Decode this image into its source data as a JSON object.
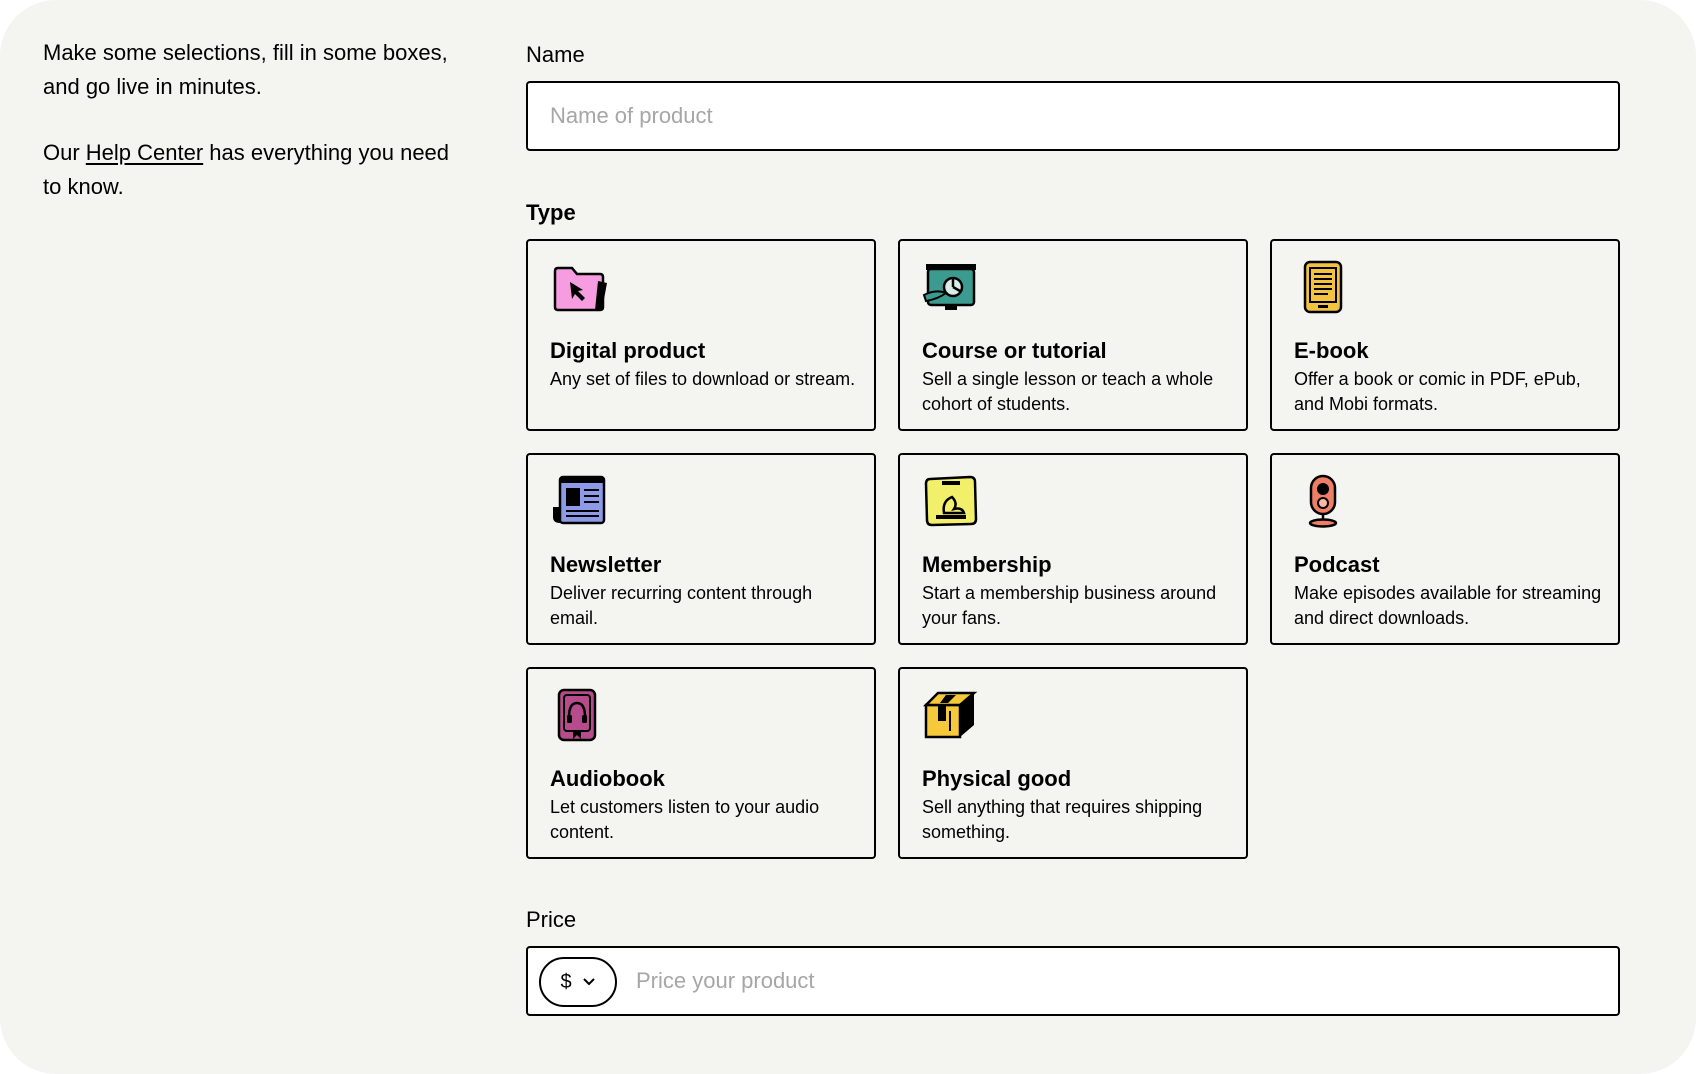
{
  "intro": {
    "line1": "Make some selections, fill in some boxes, and go live in minutes.",
    "prefix": "Our ",
    "help_link": "Help Center",
    "suffix": " has everything you need to know."
  },
  "name_field": {
    "label": "Name",
    "placeholder": "Name of product",
    "value": ""
  },
  "type_section": {
    "label": "Type",
    "cards": [
      {
        "title": "Digital product",
        "description": "Any set of files to download or stream.",
        "icon": "folder-cursor-icon",
        "color": "#f59de0"
      },
      {
        "title": "Course or tutorial",
        "description": "Sell a single lesson or teach a whole cohort of students.",
        "icon": "presentation-board-icon",
        "color": "#3c9b8f"
      },
      {
        "title": "E-book",
        "description": "Offer a book or comic in PDF, ePub, and Mobi formats.",
        "icon": "ebook-reader-icon",
        "color": "#f1c33e"
      },
      {
        "title": "Newsletter",
        "description": "Deliver recurring content through email.",
        "icon": "newspaper-icon",
        "color": "#8d9ae8"
      },
      {
        "title": "Membership",
        "description": "Start a membership business around your fans.",
        "icon": "membership-card-icon",
        "color": "#f2ef6a"
      },
      {
        "title": "Podcast",
        "description": "Make episodes available for streaming and direct downloads.",
        "icon": "microphone-icon",
        "color": "#ee7f64"
      },
      {
        "title": "Audiobook",
        "description": "Let customers listen to your audio content.",
        "icon": "audiobook-headphones-icon",
        "color": "#b64c8b"
      },
      {
        "title": "Physical good",
        "description": "Sell anything that requires shipping something.",
        "icon": "shipping-box-icon",
        "color": "#f6c93a"
      }
    ]
  },
  "price_field": {
    "label": "Price",
    "currency": "$",
    "placeholder": "Price your product",
    "value": ""
  }
}
